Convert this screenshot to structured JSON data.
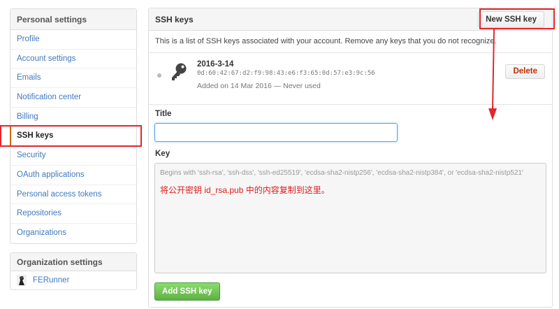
{
  "sidebar": {
    "heading": "Personal settings",
    "items": [
      {
        "label": "Profile"
      },
      {
        "label": "Account settings"
      },
      {
        "label": "Emails"
      },
      {
        "label": "Notification center"
      },
      {
        "label": "Billing"
      },
      {
        "label": "SSH keys",
        "active": true
      },
      {
        "label": "Security"
      },
      {
        "label": "OAuth applications"
      },
      {
        "label": "Personal access tokens"
      },
      {
        "label": "Repositories"
      },
      {
        "label": "Organizations"
      }
    ]
  },
  "org_settings": {
    "heading": "Organization settings",
    "org_name": "FERunner"
  },
  "main": {
    "heading": "SSH keys",
    "new_button": "New SSH key",
    "intro": "This is a list of SSH keys associated with your account. Remove any keys that you do not recognize.",
    "key": {
      "title": "2016-3-14",
      "fingerprint": "0d:60:42:67:d2:f9:98:43:e6:f3:65:0d:57:e3:9c:56",
      "added": "Added on 14 Mar 2016 — Never used",
      "delete_label": "Delete"
    },
    "form": {
      "title_label": "Title",
      "title_value": "",
      "key_label": "Key",
      "key_placeholder": "Begins with 'ssh-rsa', 'ssh-dss', 'ssh-ed25519', 'ecdsa-sha2-nistp256', 'ecdsa-sha2-nistp384', or 'ecdsa-sha2-nistp521'",
      "key_note": "将公开密钥 id_rsa.pub 中的内容复制到这里。",
      "add_button": "Add SSH key"
    }
  },
  "colors": {
    "link": "#4078c0",
    "annotation_red": "#e3262c",
    "add_green": "#60b044",
    "delete_red": "#bd2c00"
  }
}
